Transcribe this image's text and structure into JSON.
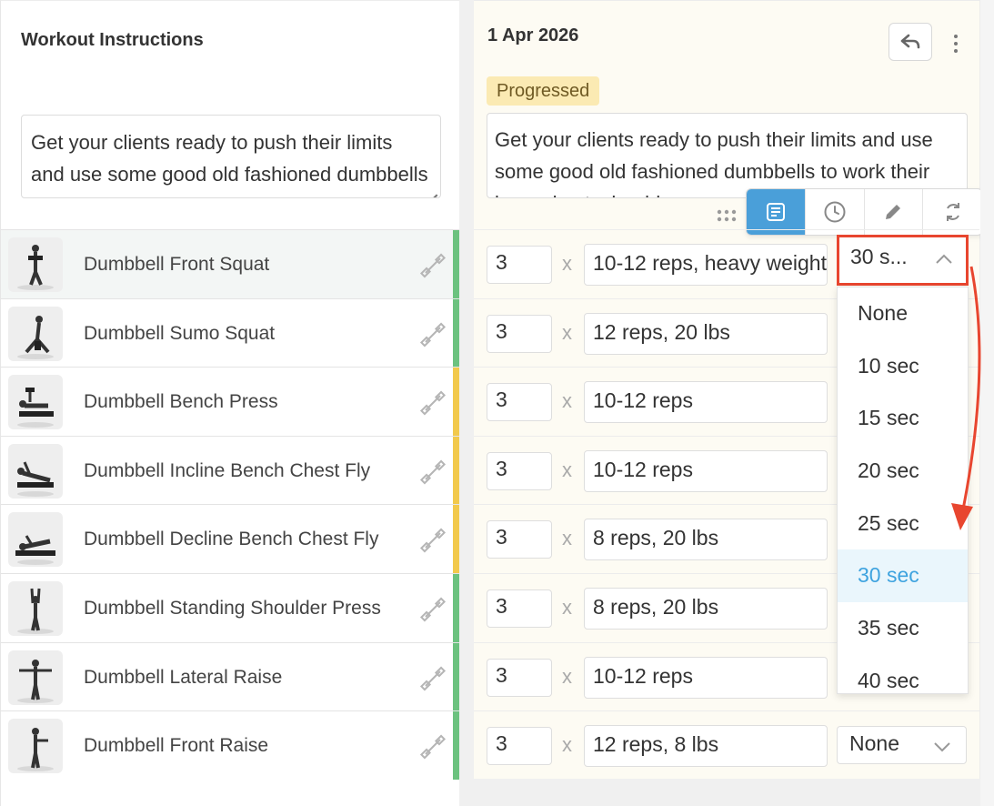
{
  "left": {
    "title": "Workout Instructions",
    "instructions": "Get your clients ready to push their limits and use some good old fashioned dumbbells to work their legs, chest, shoulders"
  },
  "exercises": [
    {
      "name": "Dumbbell Front Squat",
      "stripe": "#6cc27f"
    },
    {
      "name": "Dumbbell Sumo Squat",
      "stripe": "#6cc27f"
    },
    {
      "name": "Dumbbell Bench Press",
      "stripe": "#f2c94c"
    },
    {
      "name": "Dumbbell Incline Bench Chest Fly",
      "stripe": "#f2c94c"
    },
    {
      "name": "Dumbbell Decline Bench Chest Fly",
      "stripe": "#f2c94c"
    },
    {
      "name": "Dumbbell Standing Shoulder Press",
      "stripe": "#6cc27f"
    },
    {
      "name": "Dumbbell Lateral Raise",
      "stripe": "#6cc27f"
    },
    {
      "name": "Dumbbell Front Raise",
      "stripe": "#6cc27f"
    }
  ],
  "right": {
    "date": "1 Apr 2026",
    "badge": "Progressed",
    "instructions": "Get your clients ready to push their limits and use some good old fashioned dumbbells to work their legs, chest, shoulders"
  },
  "toolbar": {
    "icons": [
      "notes-icon",
      "clock-icon",
      "pencil-icon",
      "refresh-icon"
    ]
  },
  "sets": [
    {
      "sets": "3",
      "x": "x",
      "reps": "10-12 reps, heavy weight",
      "rest": "30 s..."
    },
    {
      "sets": "3",
      "x": "x",
      "reps": "12 reps, 20 lbs"
    },
    {
      "sets": "3",
      "x": "x",
      "reps": "10-12 reps"
    },
    {
      "sets": "3",
      "x": "x",
      "reps": "10-12 reps"
    },
    {
      "sets": "3",
      "x": "x",
      "reps": "8 reps, 20 lbs"
    },
    {
      "sets": "3",
      "x": "x",
      "reps": "8 reps, 20 lbs"
    },
    {
      "sets": "3",
      "x": "x",
      "reps": "10-12 reps"
    },
    {
      "sets": "3",
      "x": "x",
      "reps": "12 reps, 8 lbs",
      "rest": "None"
    }
  ],
  "rest_dropdown": {
    "options": [
      "None",
      "10 sec",
      "15 sec",
      "20 sec",
      "25 sec",
      "30 sec",
      "35 sec",
      "40 sec"
    ],
    "selected": "30 sec",
    "highlight_color": "#e8462f"
  }
}
